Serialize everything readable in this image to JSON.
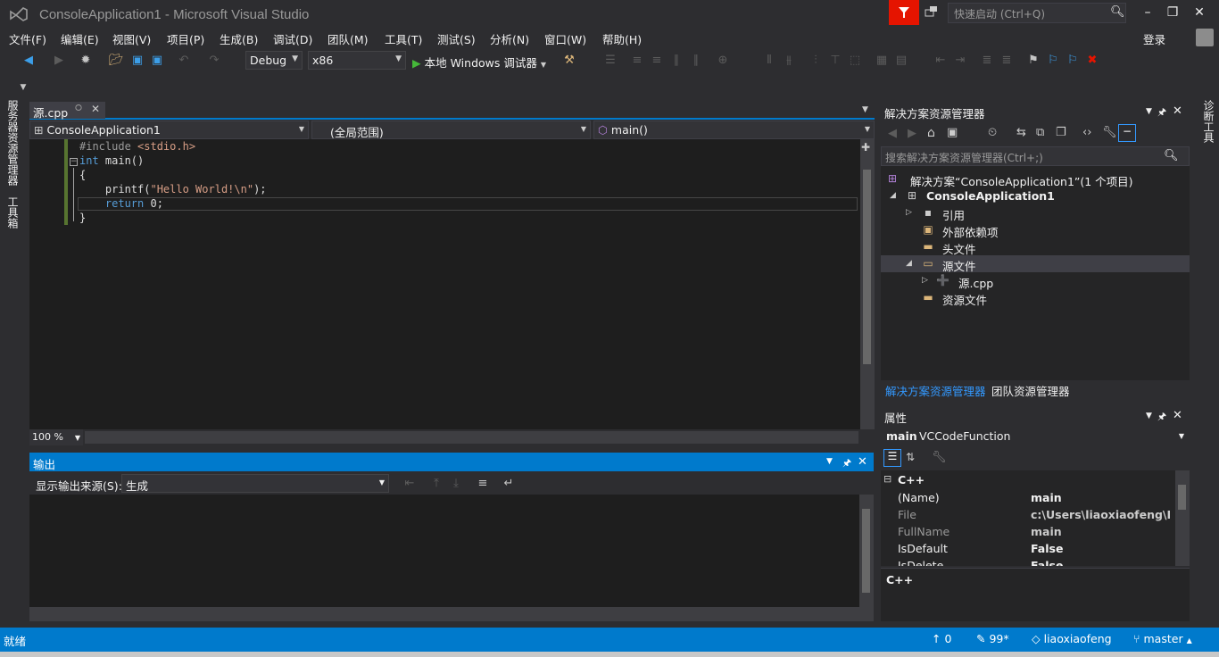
{
  "window": {
    "title": "ConsoleApplication1 - Microsoft Visual Studio",
    "quick_launch_placeholder": "快速启动 (Ctrl+Q)",
    "sign_in": "登录"
  },
  "menu": [
    "文件(F)",
    "编辑(E)",
    "视图(V)",
    "项目(P)",
    "生成(B)",
    "调试(D)",
    "团队(M)",
    "工具(T)",
    "测试(S)",
    "分析(N)",
    "窗口(W)",
    "帮助(H)"
  ],
  "toolbar": {
    "config": "Debug",
    "platform": "x86",
    "run_label": "本地 Windows 调试器"
  },
  "left_rail": {
    "server_explorer": "服务器资源管理器",
    "toolbox": "工具箱"
  },
  "right_rail": {
    "diagnostics": "诊断工具"
  },
  "editor": {
    "tab_name": "源.cpp",
    "nav_project": "ConsoleApplication1",
    "nav_scope": "(全局范围)",
    "nav_member": "main()",
    "zoom": "100 %",
    "code": {
      "include_kw": "#include",
      "include_file": "<stdio.h>",
      "int_kw": "int",
      "main_sig": " main()",
      "open_brace": "{",
      "printf_call": "printf(",
      "printf_str": "\"Hello World!\\n\"",
      "printf_end": ");",
      "return_kw": "return",
      "return_val": " 0;",
      "close_brace": "}"
    }
  },
  "output": {
    "title": "输出",
    "source_label": "显示输出来源(S):",
    "source_value": "生成"
  },
  "solution_explorer": {
    "title": "解决方案资源管理器",
    "search_placeholder": "搜索解决方案资源管理器(Ctrl+;)",
    "tree": {
      "solution": "解决方案“ConsoleApplication1”(1 个项目)",
      "project": "ConsoleApplication1",
      "references": "引用",
      "external_deps": "外部依赖项",
      "header_files": "头文件",
      "source_files": "源文件",
      "source_cpp": "源.cpp",
      "resource_files": "资源文件"
    },
    "tab_active": "解决方案资源管理器",
    "tab_team": "团队资源管理器"
  },
  "properties": {
    "title": "属性",
    "object_name": "main",
    "object_type": "VCCodeFunction",
    "category": "C++",
    "rows": [
      {
        "name": "(Name)",
        "value": "main"
      },
      {
        "name": "File",
        "value": "c:\\Users\\liaoxiaofeng\\Doc"
      },
      {
        "name": "FullName",
        "value": "main"
      },
      {
        "name": "IsDefault",
        "value": "False"
      },
      {
        "name": "IsDelete",
        "value": "False"
      }
    ],
    "description": "C++"
  },
  "status": {
    "ready": "就绪",
    "up_count": "0",
    "pending_changes": "99*",
    "user": "liaoxiaofeng",
    "branch": "master"
  },
  "colors": {
    "accent": "#007acc",
    "background": "#2d2d30",
    "editor_bg": "#1e1e1e",
    "keyword": "#569cd6",
    "string": "#d69d85",
    "notify": "#e51400"
  }
}
